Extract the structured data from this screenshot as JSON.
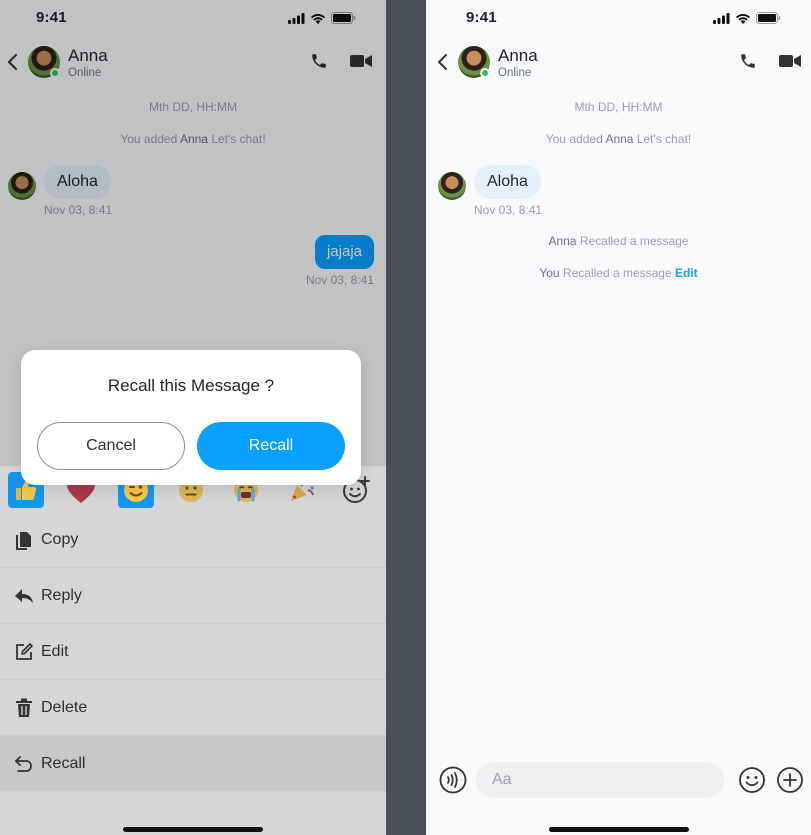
{
  "status": {
    "time": "9:41"
  },
  "contact": {
    "name": "Anna",
    "status": "Online"
  },
  "chat": {
    "date_header": "Mth DD, HH:MM",
    "added_prefix": "You added",
    "added_name": "Anna",
    "added_suffix": "Let's chat!",
    "incoming_text": "Aloha",
    "incoming_time": "Nov 03, 8:41",
    "outgoing_text": "jajaja",
    "outgoing_time": "Nov 03, 8:41"
  },
  "dialog": {
    "title": "Recall this Message ?",
    "cancel": "Cancel",
    "confirm": "Recall"
  },
  "reactions": [
    "thumbs-up",
    "heart",
    "winking-face",
    "neutral-face",
    "crying-face",
    "party-popper",
    "add-reaction"
  ],
  "menu": [
    {
      "label": "Copy",
      "icon": "copy-icon"
    },
    {
      "label": "Reply",
      "icon": "reply-icon"
    },
    {
      "label": "Edit",
      "icon": "edit-icon"
    },
    {
      "label": "Delete",
      "icon": "trash-icon"
    },
    {
      "label": "Recall",
      "icon": "recall-icon"
    }
  ],
  "recalled": {
    "anna_name": "Anna",
    "anna_text": "Recalled a message",
    "you_name": "You",
    "you_text": "Recalled a message",
    "edit_link": "Edit"
  },
  "composer": {
    "placeholder": "Aa"
  },
  "colors": {
    "accent": "#0aa0ff",
    "online": "#22c55e",
    "bubble_in": "#e6f0fb"
  }
}
